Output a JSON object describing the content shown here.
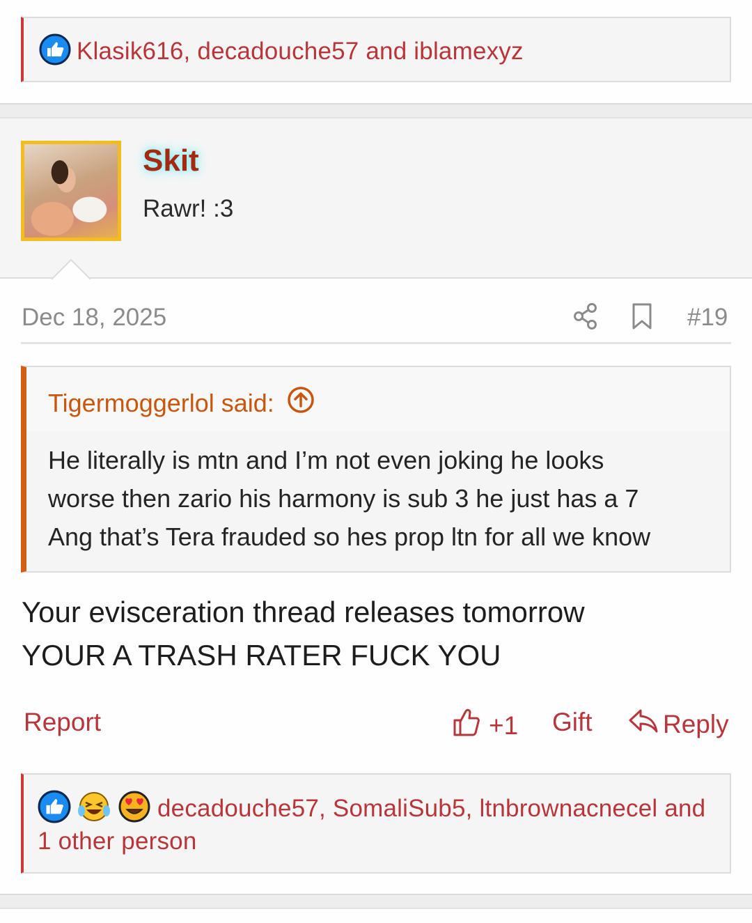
{
  "top_reactions": {
    "icon": "like-icon",
    "text": "Klasik616, decadouche57 and iblamexyz"
  },
  "post": {
    "username": "Skit",
    "user_title": "Rawr! :3",
    "date": "Dec 18, 2025",
    "number": "#19",
    "quote": {
      "author": "Tigermoggerlol said:",
      "lines": [
        "He literally is mtn and I’m not even joking he looks",
        "worse then zario his harmony is sub 3 he just has a 7",
        "Ang that’s Tera frauded so hes prop ltn for all we know"
      ]
    },
    "message": [
      "Your evisceration thread releases tomorrow",
      "YOUR A TRASH RATER FUCK YOU"
    ],
    "actions": {
      "report": "Report",
      "like": "+1",
      "gift": "Gift",
      "reply": "Reply"
    },
    "reactions": {
      "icons": [
        "like-icon",
        "laughing-crying-icon",
        "heart-eyes-icon"
      ],
      "line1": "decadouche57, SomaliSub5, ltnbrownacnecel and",
      "line2": "1 other person"
    }
  },
  "colors": {
    "accent": "#b7353b",
    "quote_accent": "#d35e17",
    "username": "#a32a10",
    "avatar_border": "#f2bd20",
    "muted": "#8b8b8b"
  }
}
